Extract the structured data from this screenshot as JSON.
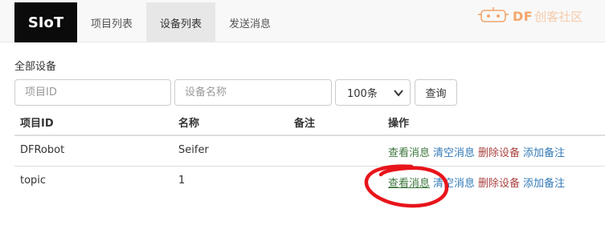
{
  "navbar": {
    "brand": "SIoT",
    "items": [
      {
        "label": "项目列表",
        "active": false
      },
      {
        "label": "设备列表",
        "active": true
      },
      {
        "label": "发送消息",
        "active": false
      }
    ]
  },
  "watermark": {
    "logo_text": "DF",
    "text": "创客社区",
    "icon": "robot-logo-icon"
  },
  "section_label": "全部设备",
  "filters": {
    "project_id_placeholder": "项目ID",
    "device_name_placeholder": "设备名称",
    "page_size": "100条",
    "query_label": "查询"
  },
  "table": {
    "headers": [
      "项目ID",
      "名称",
      "备注",
      "操作"
    ],
    "rows": [
      {
        "project_id": "DFRobot",
        "name": "Seifer",
        "note": ""
      },
      {
        "project_id": "topic",
        "name": "1",
        "note": ""
      }
    ],
    "actions": {
      "view": "查看消息",
      "clear": "清空消息",
      "delete": "删除设备",
      "note": "添加备注"
    }
  },
  "colors": {
    "view": "#3c763d",
    "clear": "#337ab7",
    "delete": "#a94442",
    "note": "#337ab7",
    "annotation": "#e8141b"
  }
}
